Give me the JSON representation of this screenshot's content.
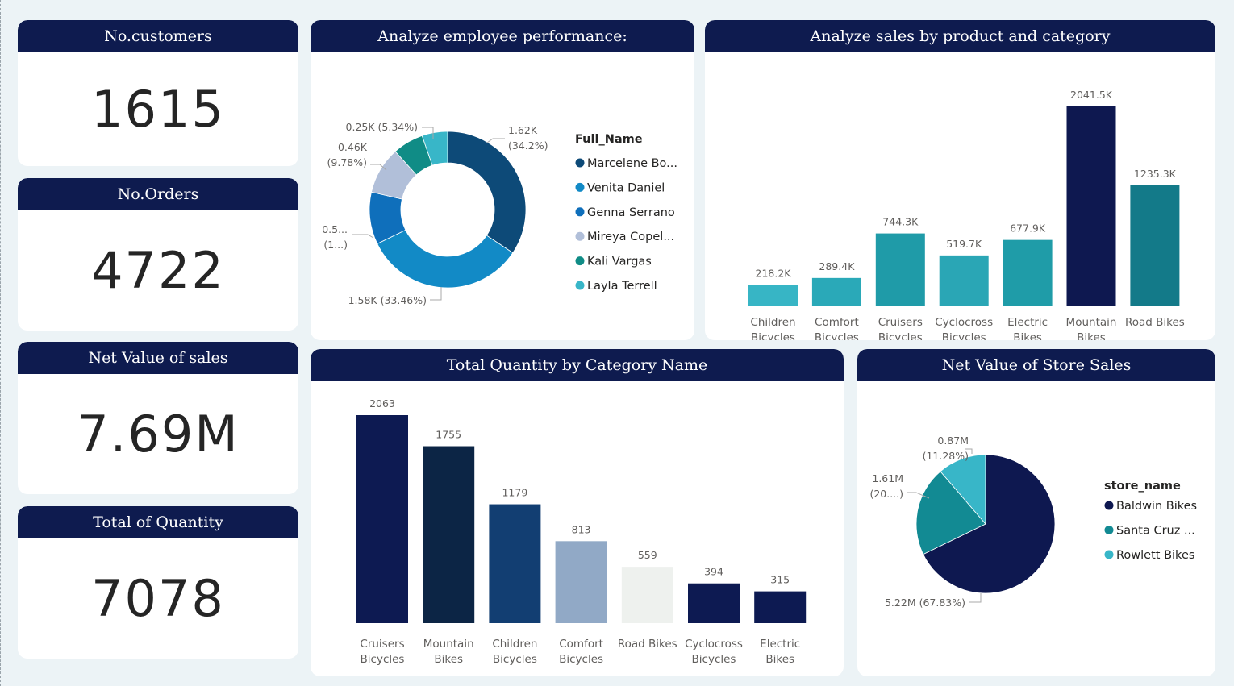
{
  "kpis": {
    "customers": {
      "title": "No.customers",
      "value": "1615"
    },
    "orders": {
      "title": "No.Orders",
      "value": "4722"
    },
    "net_sales": {
      "title": "Net Value of sales",
      "value": "7.69M"
    },
    "quantity": {
      "title": "Total of Quantity",
      "value": "7078"
    }
  },
  "chart_data": [
    {
      "type": "pie",
      "title": "Analyze employee performance:",
      "legend_title": "Full_Name",
      "legend_position": "right",
      "donut": true,
      "slices": [
        {
          "name": "Marcelene Bo...",
          "value": 1.62,
          "display": "1.62K",
          "pct": "(34.2%)",
          "color": "#0d4a78"
        },
        {
          "name": "Venita Daniel",
          "value": 1.58,
          "display": "1.58K (33.46%)",
          "pct": "",
          "color": "#128ac6"
        },
        {
          "name": "Genna Serrano",
          "value": 0.51,
          "display": "0.5...",
          "pct": "(1...)",
          "color": "#0f6fbb"
        },
        {
          "name": "Mireya Copel...",
          "value": 0.46,
          "display": "0.46K",
          "pct": "(9.78%)",
          "color": "#b1bfd9"
        },
        {
          "name": "Kali Vargas",
          "value": 0.3,
          "display": "",
          "pct": "",
          "color": "#108c86"
        },
        {
          "name": "Layla Terrell",
          "value": 0.25,
          "display": "0.25K (5.34%)",
          "pct": "",
          "color": "#38b6c8"
        }
      ]
    },
    {
      "type": "bar",
      "title": "Analyze sales by product and category",
      "categories": [
        [
          "Children",
          "Bicycles"
        ],
        [
          "Comfort",
          "Bicycles"
        ],
        [
          "Cruisers",
          "Bicycles"
        ],
        [
          "Cyclocross",
          "Bicycles"
        ],
        [
          "Electric",
          "Bikes"
        ],
        [
          "Mountain",
          "Bikes"
        ],
        [
          "Road Bikes",
          ""
        ]
      ],
      "values": [
        218.2,
        289.4,
        744.3,
        519.7,
        677.9,
        2041.5,
        1235.3
      ],
      "labels": [
        "218.2K",
        "289.4K",
        "744.3K",
        "519.7K",
        "677.9K",
        "2041.5K",
        "1235.3K"
      ],
      "colors": [
        "#37b5c5",
        "#2aa9b8",
        "#1f9ba8",
        "#2aa6b5",
        "#1f9ca8",
        "#0e1850",
        "#137a89"
      ],
      "ylim": [
        0,
        2041.5
      ],
      "grid": false
    },
    {
      "type": "bar",
      "title": "Total Quantity by Category Name",
      "categories": [
        [
          "Cruisers",
          "Bicycles"
        ],
        [
          "Mountain",
          "Bikes"
        ],
        [
          "Children",
          "Bicycles"
        ],
        [
          "Comfort",
          "Bicycles"
        ],
        [
          "Road Bikes",
          ""
        ],
        [
          "Cyclocross",
          "Bicycles"
        ],
        [
          "Electric",
          "Bikes"
        ]
      ],
      "values": [
        2063,
        1755,
        1179,
        813,
        559,
        394,
        315
      ],
      "labels": [
        "2063",
        "1755",
        "1179",
        "813",
        "559",
        "394",
        "315"
      ],
      "colors": [
        "#0d1a52",
        "#0c2545",
        "#123e72",
        "#91a9c6",
        "#eef1ee",
        "#0d1a52",
        "#0d1a52"
      ],
      "ylim": [
        0,
        2063
      ],
      "grid": false
    },
    {
      "type": "pie",
      "title": "Net Value of Store Sales",
      "legend_title": "store_name",
      "legend_position": "right",
      "donut": false,
      "slices": [
        {
          "name": "Baldwin Bikes",
          "value": 5.22,
          "display": "5.22M (67.83%)",
          "pct": "",
          "color": "#0e1850"
        },
        {
          "name": "Santa Cruz ...",
          "value": 1.61,
          "display": "1.61M",
          "pct": "(20....)",
          "color": "#128a93"
        },
        {
          "name": "Rowlett Bikes",
          "value": 0.87,
          "display": "0.87M",
          "pct": "(11.28%)",
          "color": "#38b6c8"
        }
      ]
    }
  ]
}
